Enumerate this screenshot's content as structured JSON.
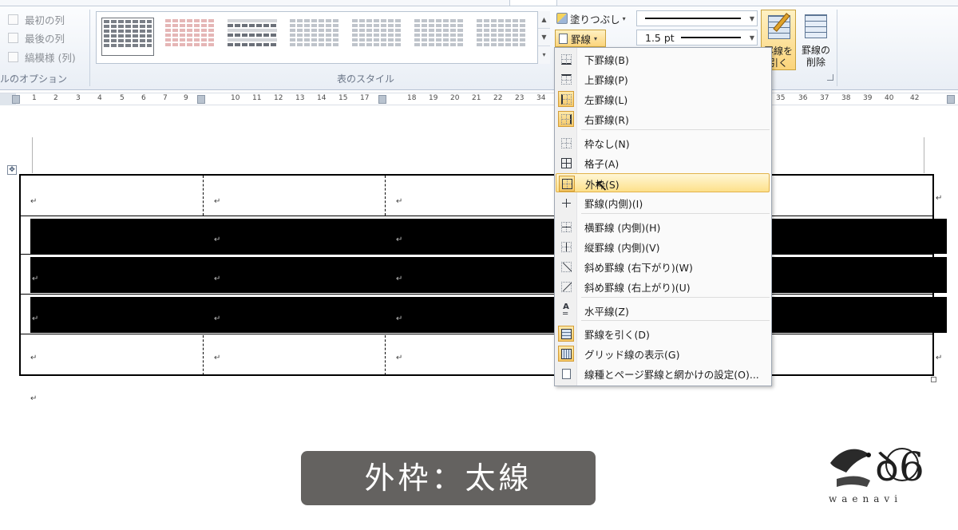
{
  "ribbon": {
    "options": [
      {
        "label": "最初の列"
      },
      {
        "label": "最後の列"
      },
      {
        "label": "縞模様 (列)"
      }
    ],
    "options_group_label": "ルのオプション",
    "styles_group_label": "表のスタイル",
    "fill_label": "塗りつぶし",
    "borders_label": "罫線",
    "pen_weight": "1.5 pt",
    "draw_table_label": [
      "罫線を",
      "引く"
    ],
    "eraser_label": [
      "罫線の",
      "削除"
    ]
  },
  "ruler": {
    "ticks": [
      "1",
      "2",
      "3",
      "4",
      "5",
      "6",
      "7",
      "9",
      "10",
      "11",
      "12",
      "13",
      "14",
      "15",
      "17",
      "18",
      "19",
      "20",
      "21",
      "22",
      "23",
      "34",
      "35",
      "36",
      "37",
      "38",
      "39",
      "40",
      "42"
    ]
  },
  "document": {
    "paragraph_mark": "↵"
  },
  "borders_menu": {
    "items": [
      {
        "label": "下罫線(B)",
        "icon": "bottom-border-icon",
        "checked": false
      },
      {
        "label": "上罫線(P)",
        "icon": "top-border-icon",
        "checked": false
      },
      {
        "label": "左罫線(L)",
        "icon": "left-border-icon",
        "checked": true
      },
      {
        "label": "右罫線(R)",
        "icon": "right-border-icon",
        "checked": true
      },
      {
        "label": "枠なし(N)",
        "icon": "no-border-icon",
        "checked": false
      },
      {
        "label": "格子(A)",
        "icon": "all-borders-icon",
        "checked": false
      },
      {
        "label": "外枠(S)",
        "icon": "outside-borders-icon",
        "checked": true,
        "hover": true
      },
      {
        "label": "罫線(内側)(I)",
        "icon": "inside-borders-icon",
        "checked": false
      },
      {
        "label": "横罫線 (内側)(H)",
        "icon": "inside-horizontal-border-icon",
        "checked": false
      },
      {
        "label": "縦罫線 (内側)(V)",
        "icon": "inside-vertical-border-icon",
        "checked": false
      },
      {
        "label": "斜め罫線 (右下がり)(W)",
        "icon": "diagonal-down-border-icon",
        "checked": false
      },
      {
        "label": "斜め罫線 (右上がり)(U)",
        "icon": "diagonal-up-border-icon",
        "checked": false
      },
      {
        "label": "水平線(Z)",
        "icon": "horizontal-line-icon",
        "checked": false
      },
      {
        "label": "罫線を引く(D)",
        "icon": "draw-table-icon",
        "checked": true
      },
      {
        "label": "グリッド線の表示(G)",
        "icon": "view-gridlines-icon",
        "checked": true
      },
      {
        "label": "線種とページ罫線と網かけの設定(O)...",
        "icon": "borders-shading-icon",
        "checked": false
      }
    ]
  },
  "caption": "外枠：太線",
  "logo_text": "waenavi"
}
